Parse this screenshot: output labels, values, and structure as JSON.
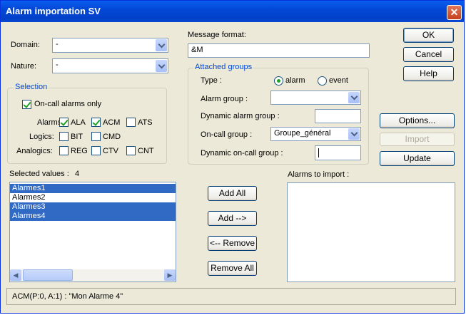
{
  "window": {
    "title": "Alarm importation SV",
    "close_glyph": "✕"
  },
  "domain": {
    "label": "Domain:",
    "value": "-"
  },
  "nature": {
    "label": "Nature:",
    "value": "-"
  },
  "selection": {
    "title": "Selection",
    "oncall_only": {
      "label": "On-call alarms only",
      "checked": true
    },
    "rows": [
      {
        "label": "Alarms:",
        "options": [
          {
            "label": "ALA",
            "checked": true
          },
          {
            "label": "ACM",
            "checked": true
          },
          {
            "label": "ATS",
            "checked": false
          }
        ]
      },
      {
        "label": "Logics:",
        "options": [
          {
            "label": "BIT",
            "checked": false
          },
          {
            "label": "CMD",
            "checked": false
          }
        ]
      },
      {
        "label": "Analogics:",
        "options": [
          {
            "label": "REG",
            "checked": false
          },
          {
            "label": "CTV",
            "checked": false
          },
          {
            "label": "CNT",
            "checked": false
          }
        ]
      }
    ]
  },
  "message_format": {
    "label": "Message format:",
    "value": "&M"
  },
  "attached_groups": {
    "title": "Attached groups",
    "type": {
      "label": "Type :",
      "option_alarm": "alarm",
      "option_event": "event",
      "selected": "alarm"
    },
    "alarm_group": {
      "label": "Alarm group :",
      "value": ""
    },
    "dynamic_alarm_group": {
      "label": "Dynamic alarm group :",
      "value": ""
    },
    "oncall_group": {
      "label": "On-call group :",
      "value": "Groupe_général"
    },
    "dynamic_oncall_group": {
      "label": "Dynamic on-call group :",
      "value": ""
    }
  },
  "buttons": {
    "ok": "OK",
    "cancel": "Cancel",
    "help": "Help",
    "options": "Options...",
    "import": "Import",
    "update": "Update",
    "add_all": "Add All",
    "add": "Add -->",
    "remove": "<-- Remove",
    "remove_all": "Remove All"
  },
  "selected_values": {
    "label": "Selected values :",
    "count": "4",
    "items": [
      {
        "text": "Alarmes1",
        "selected": true
      },
      {
        "text": "Alarmes2",
        "selected": false
      },
      {
        "text": "Alarmes3",
        "selected": true
      },
      {
        "text": "Alarmes4",
        "selected": true
      }
    ]
  },
  "alarms_to_import": {
    "label": "Alarms to import :",
    "items": []
  },
  "status_bar": {
    "text": "ACM(P:0, A:1) : \"Mon Alarme 4\""
  },
  "scrollbar": {
    "left_glyph": "◀",
    "right_glyph": "▶"
  }
}
